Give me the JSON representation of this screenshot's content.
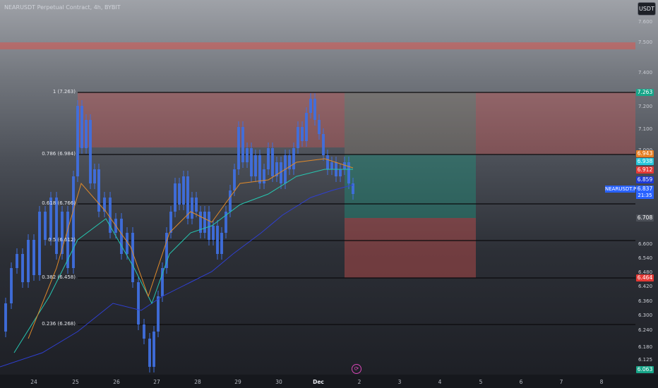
{
  "header": {
    "symbol_title": "NEARUSDT Perpetual Contract, 4h, BYBIT",
    "currency_label": "USDT"
  },
  "price_axis": {
    "ticks": [
      "7.600",
      "7.500",
      "7.400",
      "7.300",
      "7.200",
      "7.100",
      "7.000",
      "6.900",
      "6.800",
      "6.700",
      "6.600",
      "6.540",
      "6.480",
      "6.420",
      "6.360",
      "6.300",
      "6.240",
      "6.180",
      "6.125",
      "6.060"
    ]
  },
  "price_tags": [
    {
      "label": "7.263",
      "color": "#17a589"
    },
    {
      "label": "6.943",
      "color": "#e67e22"
    },
    {
      "label": "6.938",
      "color": "#26c6da"
    },
    {
      "label": "6.912",
      "color": "#e53935"
    },
    {
      "label": "6.859",
      "color": "#1e3ad6"
    },
    {
      "label": "6.708",
      "color": "#4b4f57"
    },
    {
      "label": "6.464",
      "color": "#e53935"
    },
    {
      "label": "6.063",
      "color": "#17a589"
    }
  ],
  "symbol_tag": {
    "name": "NEARUSDT.P",
    "price": "6.837",
    "countdown": "21:35"
  },
  "fib_levels": [
    {
      "label": "1 (7.263)",
      "price": 7.263
    },
    {
      "label": "0.786 (6.984)",
      "price": 6.984
    },
    {
      "label": "0.618 (6.766)",
      "price": 6.766
    },
    {
      "label": "0.5 (6.612)",
      "price": 6.612
    },
    {
      "label": "0.382 (6.458)",
      "price": 6.458
    },
    {
      "label": "0.236 (6.268)",
      "price": 6.268
    }
  ],
  "time_axis": {
    "labels": [
      "24",
      "25",
      "26",
      "27",
      "28",
      "29",
      "30",
      "Dec",
      "2",
      "3",
      "4",
      "5",
      "6",
      "7",
      "8"
    ]
  },
  "colors": {
    "resistance_zone": "#d9534f",
    "target_zone": "#1f8f7a",
    "ma_blue": "#2f3fd0",
    "ma_cyan": "#26c6b0",
    "ma_orange": "#e08a2a",
    "candle": "#3f6fe0"
  },
  "icons": {
    "replay": "replay-icon"
  }
}
